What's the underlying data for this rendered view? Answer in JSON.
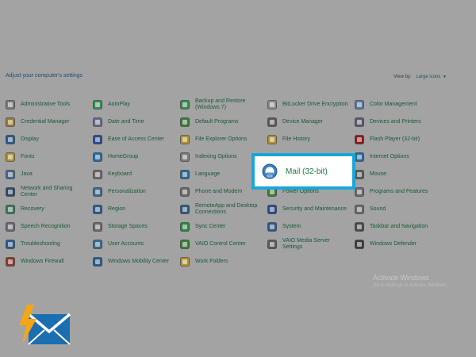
{
  "header": {
    "title": "Adjust your computer's settings",
    "view_by_label": "View by:",
    "view_by_value": "Large icons"
  },
  "items": [
    {
      "label": "Administrative Tools",
      "icon": "tools-icon",
      "color": "#7a7a7a"
    },
    {
      "label": "AutoPlay",
      "icon": "autoplay-icon",
      "color": "#3a8a5a"
    },
    {
      "label": "Backup and Restore (Windows 7)",
      "icon": "backup-icon",
      "color": "#3a8a4a"
    },
    {
      "label": "BitLocker Drive Encryption",
      "icon": "bitlocker-icon",
      "color": "#8a8a8a"
    },
    {
      "label": "Color Management",
      "icon": "color-management-icon",
      "color": "#5a7a9a"
    },
    {
      "label": "Credential Manager",
      "icon": "credential-icon",
      "color": "#9a7a3a"
    },
    {
      "label": "Date and Time",
      "icon": "clock-icon",
      "color": "#6a6a8a"
    },
    {
      "label": "Default Programs",
      "icon": "default-programs-icon",
      "color": "#3a7a3a"
    },
    {
      "label": "Device Manager",
      "icon": "device-manager-icon",
      "color": "#5a5a5a"
    },
    {
      "label": "Devices and Printers",
      "icon": "printer-icon",
      "color": "#5a5a6a"
    },
    {
      "label": "Display",
      "icon": "display-icon",
      "color": "#2a5a8a"
    },
    {
      "label": "Ease of Access Center",
      "icon": "ease-of-access-icon",
      "color": "#2a4a8a"
    },
    {
      "label": "File Explorer Options",
      "icon": "folder-options-icon",
      "color": "#b09030"
    },
    {
      "label": "File History",
      "icon": "file-history-icon",
      "color": "#b09030"
    },
    {
      "label": "Flash Player (32-bit)",
      "icon": "flash-icon",
      "color": "#8a1a1a"
    },
    {
      "label": "Fonts",
      "icon": "fonts-icon",
      "color": "#b09030"
    },
    {
      "label": "HomeGroup",
      "icon": "homegroup-icon",
      "color": "#2a6a9a"
    },
    {
      "label": "Indexing Options",
      "icon": "indexing-icon",
      "color": "#7a7a7a"
    },
    {
      "label": "",
      "icon": "",
      "color": ""
    },
    {
      "label": "Internet Options",
      "icon": "internet-icon",
      "color": "#2a6a9a"
    },
    {
      "label": "Java",
      "icon": "java-icon",
      "color": "#4a6a8a"
    },
    {
      "label": "Keyboard",
      "icon": "keyboard-icon",
      "color": "#6a6a6a"
    },
    {
      "label": "Language",
      "icon": "language-icon",
      "color": "#2a6a9a"
    },
    {
      "label": "",
      "icon": "",
      "color": ""
    },
    {
      "label": "Mouse",
      "icon": "mouse-icon",
      "color": "#5a5a5a"
    },
    {
      "label": "Network and Sharing Center",
      "icon": "network-icon",
      "color": "#2a4a6a"
    },
    {
      "label": "Personalization",
      "icon": "personalization-icon",
      "color": "#3a6a8a"
    },
    {
      "label": "Phone and Modem",
      "icon": "phone-icon",
      "color": "#6a6a6a"
    },
    {
      "label": "Power Options",
      "icon": "power-icon",
      "color": "#3a7a3a"
    },
    {
      "label": "Programs and Features",
      "icon": "programs-icon",
      "color": "#6a6a6a"
    },
    {
      "label": "Recovery",
      "icon": "recovery-icon",
      "color": "#3a7a5a"
    },
    {
      "label": "Region",
      "icon": "region-icon",
      "color": "#2a5a8a"
    },
    {
      "label": "RemoteApp and Desktop Connections",
      "icon": "remoteapp-icon",
      "color": "#2a5a7a"
    },
    {
      "label": "Security and Maintenance",
      "icon": "security-icon",
      "color": "#2a4a8a"
    },
    {
      "label": "Sound",
      "icon": "sound-icon",
      "color": "#6a6a6a"
    },
    {
      "label": "Speech Recognition",
      "icon": "microphone-icon",
      "color": "#6a6a7a"
    },
    {
      "label": "Storage Spaces",
      "icon": "storage-icon",
      "color": "#6a6a6a"
    },
    {
      "label": "Sync Center",
      "icon": "sync-icon",
      "color": "#2a8a3a"
    },
    {
      "label": "System",
      "icon": "system-icon",
      "color": "#2a5a8a"
    },
    {
      "label": "Taskbar and Navigation",
      "icon": "taskbar-icon",
      "color": "#4a4a4a"
    },
    {
      "label": "Troubleshooting",
      "icon": "troubleshooting-icon",
      "color": "#2a5a8a"
    },
    {
      "label": "User Accounts",
      "icon": "user-accounts-icon",
      "color": "#3a6a8a"
    },
    {
      "label": "VAIO Control Center",
      "icon": "vaio-control-icon",
      "color": "#3a7a3a"
    },
    {
      "label": "VAIO Media Server Settings",
      "icon": "vaio-media-icon",
      "color": "#5a5a5a"
    },
    {
      "label": "Windows Defender",
      "icon": "defender-icon",
      "color": "#3a3a3a"
    },
    {
      "label": "Windows Firewall",
      "icon": "firewall-icon",
      "color": "#8a3a2a"
    },
    {
      "label": "Windows Mobility Center",
      "icon": "mobility-icon",
      "color": "#2a5a8a"
    },
    {
      "label": "Work Folders",
      "icon": "work-folders-icon",
      "color": "#b09030"
    }
  ],
  "highlight": {
    "label": "Mail (32-bit)",
    "icon": "mail-icon",
    "border_color": "#1aa6d8"
  },
  "watermark": {
    "title": "Activate Windows",
    "subtitle": "Go to Settings to activate Windows."
  },
  "brand": {
    "logo_icon": "email-lightning-logo-icon"
  },
  "colors": {
    "background": "#a3a3a3",
    "item_text": "#175a3a",
    "header_text": "#1d4f6e",
    "highlight_text": "#1f7a3c"
  }
}
